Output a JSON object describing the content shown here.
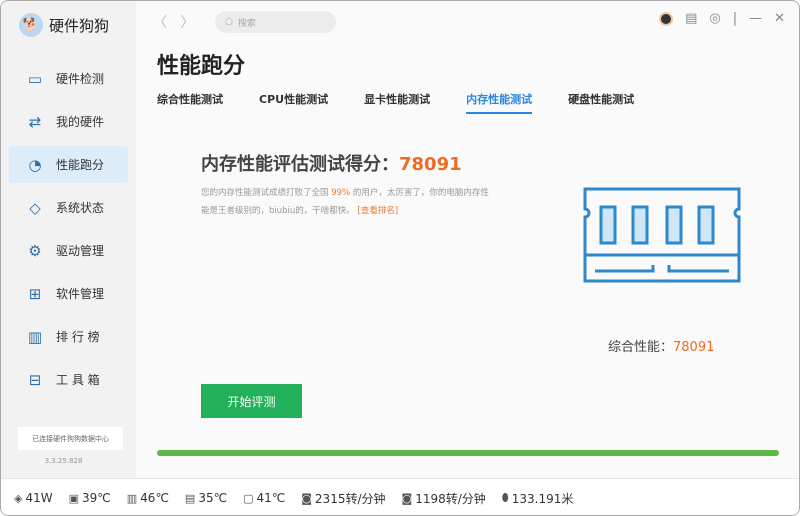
{
  "app": {
    "name": "硬件狗狗",
    "version": "3.3.25.828",
    "connection": "已连接硬件狗狗数据中心"
  },
  "sidebar": {
    "items": [
      {
        "label": "硬件检测",
        "icon": "monitor-icon"
      },
      {
        "label": "我的硬件",
        "icon": "hardware-icon"
      },
      {
        "label": "性能跑分",
        "icon": "gauge-icon"
      },
      {
        "label": "系统状态",
        "icon": "pulse-icon"
      },
      {
        "label": "驱动管理",
        "icon": "gear-icon"
      },
      {
        "label": "软件管理",
        "icon": "apps-icon"
      },
      {
        "label": "排 行 榜",
        "icon": "rank-icon"
      },
      {
        "label": "工 具 箱",
        "icon": "toolbox-icon"
      }
    ]
  },
  "search": {
    "placeholder": "搜索"
  },
  "page": {
    "title": "性能跑分",
    "tabs": [
      "综合性能测试",
      "CPU性能测试",
      "显卡性能测试",
      "内存性能测试",
      "硬盘性能测试"
    ],
    "heading": "内存性能评估测试得分：",
    "score": "78091",
    "desc_1": "您的内存性能测试成绩打败了全国 ",
    "percent": "99%",
    "desc_2": " 的用户，太厉害了，你的电脑内存性能是王者级别的，biubiu的，干啥都快。",
    "rank_link": "[查看排名]",
    "total_label": "综合性能：",
    "total_score": "78091",
    "start_button": "开始评测",
    "progress": 100
  },
  "status": [
    {
      "icon": "power-icon",
      "value": "41W"
    },
    {
      "icon": "cpu-icon",
      "value": "39℃"
    },
    {
      "icon": "motherboard-icon",
      "value": "46℃"
    },
    {
      "icon": "gpu-icon",
      "value": "35℃"
    },
    {
      "icon": "disk-icon",
      "value": "41℃"
    },
    {
      "icon": "fan-icon",
      "value": "2315转/分钟"
    },
    {
      "icon": "fan-icon",
      "value": "1198转/分钟"
    },
    {
      "icon": "mouse-icon",
      "value": "133.191米"
    }
  ],
  "colors": {
    "accent": "#2b87e0",
    "score": "#f06a22",
    "button": "#22b15a",
    "progress": "#5cb947"
  }
}
